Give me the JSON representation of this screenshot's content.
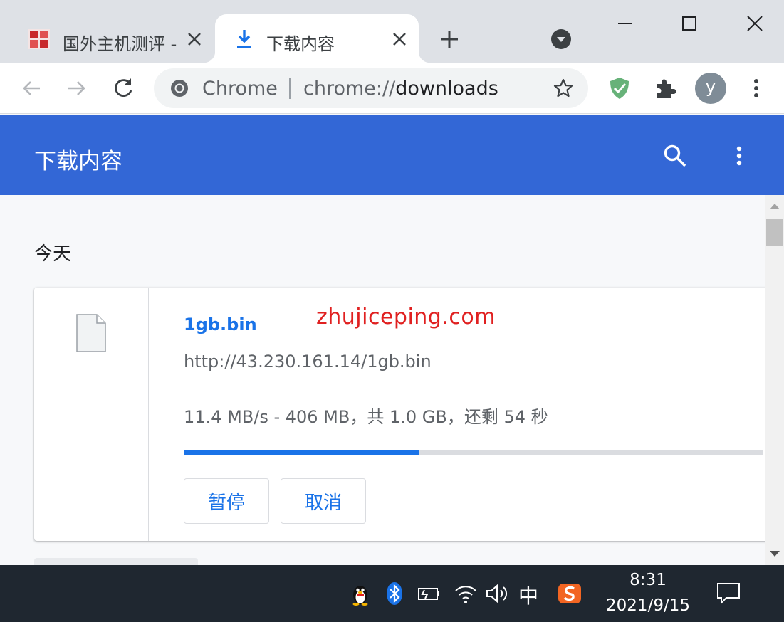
{
  "browser": {
    "tabs": [
      {
        "title": "国外主机测评 - ",
        "active": false,
        "favicon": "red-seal-favicon"
      },
      {
        "title": "下载内容",
        "active": true,
        "favicon": "download-arrow-icon"
      }
    ],
    "omnibox": {
      "chip_label": "Chrome",
      "url_scheme": "chrome://",
      "url_host": "downloads"
    },
    "profile_initial": "y"
  },
  "downloads_page": {
    "title": "下载内容",
    "date_heading": "今天",
    "items": [
      {
        "file_name": "1gb.bin",
        "url": "http://43.230.161.14/1gb.bin",
        "status": "11.4 MB/s - 406 MB，共 1.0 GB，还剩 54 秒",
        "progress_fraction": 0.406,
        "actions": {
          "pause": "暂停",
          "cancel": "取消"
        }
      }
    ],
    "watermark": "zhujiceping.com"
  },
  "taskbar": {
    "ime_label": "中",
    "time": "8:31",
    "date": "2021/9/15"
  },
  "colors": {
    "header_blue": "#3367d6",
    "link_blue": "#1a73e8",
    "watermark_red": "#e02020",
    "taskbar": "#1f2730"
  }
}
